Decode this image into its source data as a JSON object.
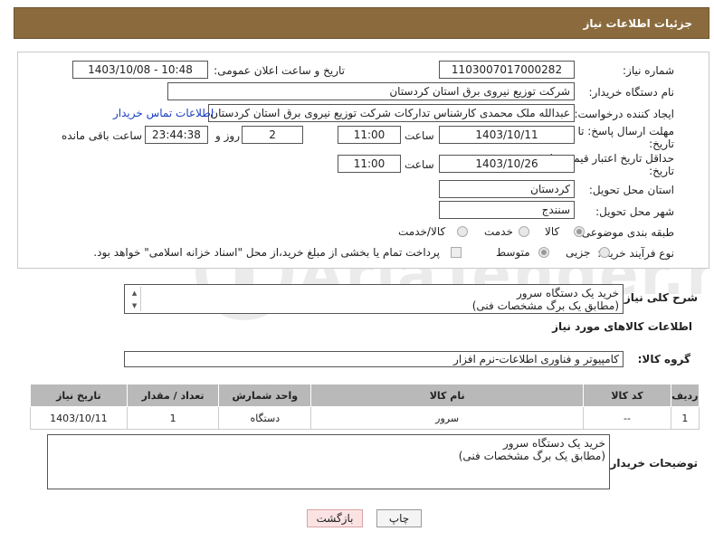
{
  "header": {
    "title": "جزئیات اطلاعات نیاز"
  },
  "fields": {
    "need_number_label": "شماره نیاز:",
    "need_number": "1103007017000282",
    "announce_label": "تاریخ و ساعت اعلان عمومی:",
    "announce_value": "1403/10/08 - 10:48",
    "buyer_label": "نام دستگاه خریدار:",
    "buyer_value": "شرکت توزیع نیروی برق استان کردستان",
    "creator_label": "ایجاد کننده درخواست:",
    "creator_value": "عبدالله ملک محمدی کارشناس تدارکات شرکت توزیع نیروی برق استان کردستان",
    "contact_link": "اطلاعات تماس خریدار",
    "deadline_label_1": "مهلت ارسال پاسخ: تا",
    "deadline_label_2": "تاریخ:",
    "deadline_date": "1403/10/11",
    "time_label": "ساعت",
    "deadline_time": "11:00",
    "days_value": "2",
    "days_label": "روز و",
    "remaining_time": "23:44:38",
    "remaining_label": "ساعت باقی مانده",
    "validity_label_1": "حداقل تاریخ اعتبار قیمت: تا",
    "validity_label_2": "تاریخ:",
    "validity_date": "1403/10/26",
    "validity_time": "11:00",
    "province_label": "استان محل تحویل:",
    "province_value": "کردستان",
    "city_label": "شهر محل تحویل:",
    "city_value": "سنندج",
    "category_label": "طبقه بندی موضوعی:",
    "category_options": [
      "کالا",
      "خدمت",
      "کالا/خدمت"
    ],
    "process_label": "نوع فرآیند خرید :",
    "process_options": [
      "جزیی",
      "متوسط"
    ],
    "payment_note": "پرداخت تمام یا بخشی از مبلغ خرید،از محل \"اسناد خزانه اسلامی\" خواهد بود."
  },
  "description": {
    "label": "شرح کلی نیاز:",
    "line1": "خرید یک دستگاه سرور",
    "line2": "(مطابق یک برگ مشخصات فنی)"
  },
  "goods_section": {
    "title": "اطلاعات کالاهای مورد نیاز",
    "group_label": "گروه کالا:",
    "group_value": "کامپیوتر و فناوری اطلاعات-نرم افزار"
  },
  "table": {
    "headers": [
      "ردیف",
      "کد کالا",
      "نام کالا",
      "واحد شمارش",
      "تعداد / مقدار",
      "تاریخ نیاز"
    ],
    "rows": [
      {
        "row": "1",
        "code": "--",
        "name": "سرور",
        "unit": "دستگاه",
        "qty": "1",
        "date": "1403/10/11"
      }
    ]
  },
  "buyer_notes": {
    "label": "توضیحات خریدار:",
    "line1": "خرید یک دستگاه سرور",
    "line2": "(مطابق یک برگ مشخصات فنی)"
  },
  "buttons": {
    "print": "چاپ",
    "back": "بازگشت"
  },
  "watermark": {
    "text": "AriaTender.neT"
  },
  "colors": {
    "header_bg": "#8b6b3e",
    "link": "#1a3fbf",
    "table_header": "#b9b9b9"
  }
}
